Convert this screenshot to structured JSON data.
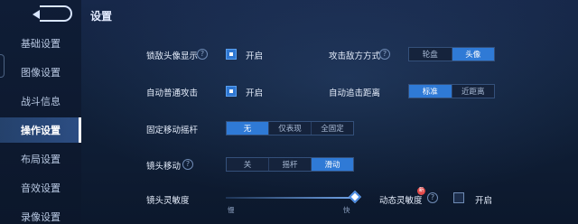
{
  "page": {
    "title": "设置"
  },
  "sidebar": {
    "items": [
      {
        "label": "基础设置"
      },
      {
        "label": "图像设置"
      },
      {
        "label": "战斗信息"
      },
      {
        "label": "操作设置"
      },
      {
        "label": "布局设置"
      },
      {
        "label": "音效设置"
      },
      {
        "label": "录像设置"
      }
    ],
    "active": "操作设置"
  },
  "settings": {
    "lock_avatar": {
      "label": "锁敌头像显示",
      "toggle_label": "开启",
      "checked": true
    },
    "attack_enemy": {
      "label": "攻击敌方方式",
      "options": [
        "轮盘",
        "头像"
      ],
      "selected": "头像"
    },
    "auto_attack": {
      "label": "自动普通攻击",
      "toggle_label": "开启",
      "checked": true
    },
    "auto_chase": {
      "label": "自动追击距离",
      "options": [
        "标准",
        "近距离"
      ],
      "selected": "标准"
    },
    "fixed_joystick": {
      "label": "固定移动摇杆",
      "options": [
        "无",
        "仅表现",
        "全固定"
      ],
      "selected": "无"
    },
    "camera_move": {
      "label": "镜头移动",
      "options": [
        "关",
        "摇杆",
        "滑动"
      ],
      "selected": "滑动"
    },
    "camera_sensitivity": {
      "label": "镜头灵敏度",
      "min_label": "慢",
      "max_label": "快",
      "value": 1.0
    },
    "dynamic_sensitivity": {
      "label": "动态灵敏度",
      "badge": "新",
      "toggle_label": "开启",
      "checked": false
    }
  },
  "icons": {
    "help": "help-icon",
    "back": "back-arrow-icon"
  },
  "colors": {
    "accent": "#2f7ad6",
    "background": "#0f1c33"
  }
}
